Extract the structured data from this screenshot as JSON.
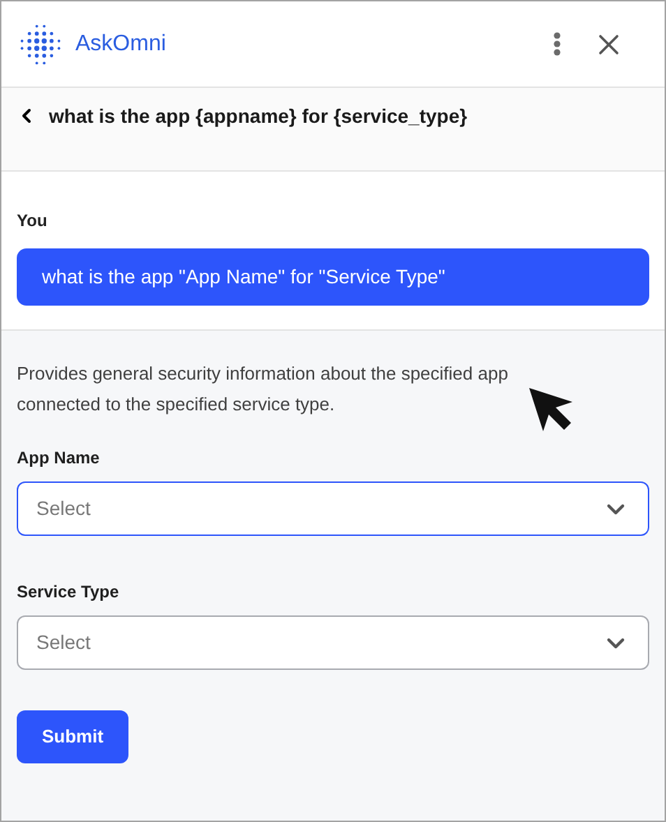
{
  "header": {
    "title": "AskOmni"
  },
  "query": {
    "title": "what is the app {appname} for {service_type}"
  },
  "message": {
    "sender": "You",
    "text": "what is the app \"App Name\" for \"Service Type\""
  },
  "description": "Provides general security information about the specified app connected to the specified service type.",
  "fields": [
    {
      "label": "App Name",
      "placeholder": "Select",
      "focused": true
    },
    {
      "label": "Service Type",
      "placeholder": "Select",
      "focused": false
    }
  ],
  "submit": "Submit"
}
